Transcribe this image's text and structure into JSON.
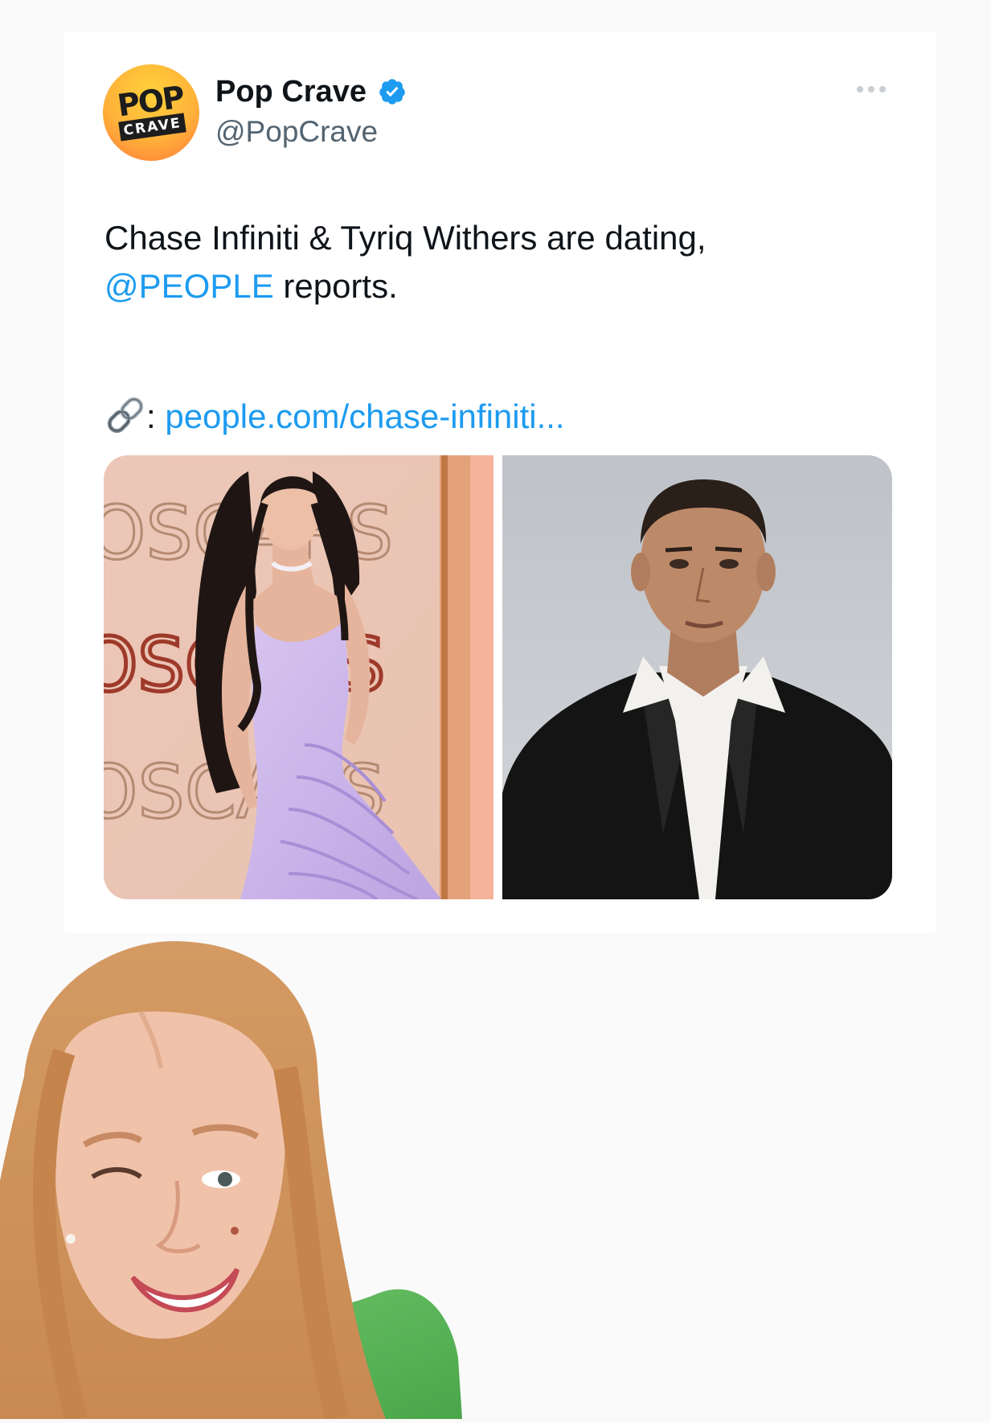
{
  "tweet": {
    "author": {
      "display_name": "Pop Crave",
      "handle": "@PopCrave",
      "verified": true,
      "avatar": {
        "logo_top": "POP",
        "logo_bottom": "CRAVE"
      }
    },
    "text": {
      "line1": "Chase Infiniti & Tyriq Withers are dating,",
      "mention": "@PEOPLE",
      "after_mention": " reports."
    },
    "link": {
      "emoji": "link-icon",
      "separator": ": ",
      "url": "people.com/chase-infiniti..."
    },
    "media": {
      "photos": [
        {
          "name": "photo-chase-infiniti",
          "backdrop_text": "OSCARS"
        },
        {
          "name": "photo-tyriq-withers"
        }
      ]
    },
    "colors": {
      "accent": "#1d9bf0",
      "text": "#0f1419",
      "muted": "#536471"
    }
  }
}
